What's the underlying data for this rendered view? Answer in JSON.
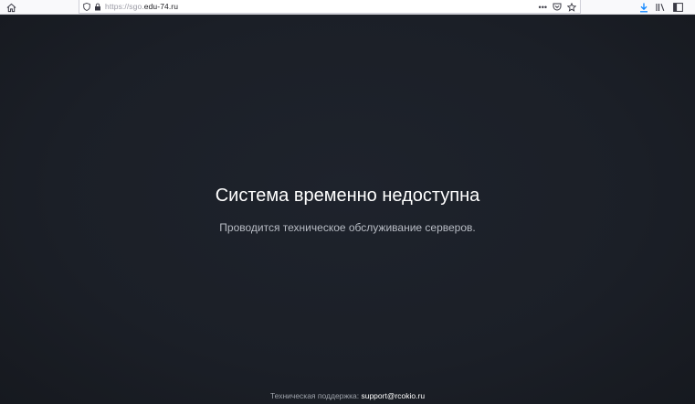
{
  "browser": {
    "url_scheme": "https://sgo.",
    "url_host": "edu-74.ru",
    "url_full": "https://sgo.edu-74.ru",
    "overflow_label": "•••",
    "icons": [
      "home-icon",
      "shield-icon",
      "lock-icon",
      "pocket-icon",
      "bookmark-star-icon",
      "download-icon",
      "library-icon",
      "sidebar-icon"
    ],
    "accent_color": "#0a84ff"
  },
  "page": {
    "title": "Система временно недоступна",
    "message": "Проводится техническое обслуживание серверов.",
    "support_label": "Техническая поддержка:",
    "support_email": "support@rcokio.ru",
    "background_color": "#1b1f27"
  }
}
